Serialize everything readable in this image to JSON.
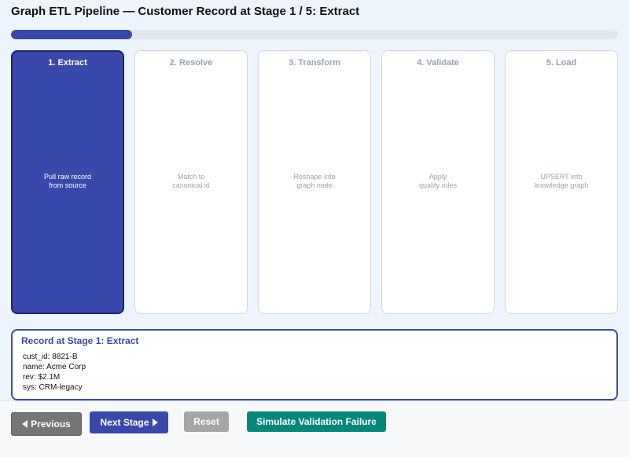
{
  "title": "Graph ETL Pipeline — Customer Record at Stage 1 / 5: Extract",
  "progress": {
    "current_stage": 1,
    "total_stages": 5,
    "fraction": 0.2
  },
  "stages": [
    {
      "label": "1. Extract",
      "desc": [
        "Pull raw record",
        "from source"
      ],
      "active": true
    },
    {
      "label": "2. Resolve",
      "desc": [
        "Match to",
        "canonical id"
      ],
      "active": false
    },
    {
      "label": "3. Transform",
      "desc": [
        "Reshape into",
        "graph node"
      ],
      "active": false
    },
    {
      "label": "4. Validate",
      "desc": [
        "Apply",
        "quality rules"
      ],
      "active": false
    },
    {
      "label": "5. Load",
      "desc": [
        "UPSERT into",
        "knowledge graph"
      ],
      "active": false
    }
  ],
  "record": {
    "title": "Record at Stage 1: Extract",
    "fields": [
      "cust_id: 8821-B",
      "name: Acme Corp",
      "rev: $2.1M",
      "sys: CRM-legacy"
    ]
  },
  "buttons": {
    "previous": "Previous",
    "next": "Next Stage",
    "reset": "Reset",
    "simulate": "Simulate Validation Failure"
  },
  "colors": {
    "accent": "#3949ab",
    "accent_dark": "#1a237e",
    "muted_text": "#9aa3ad",
    "teal": "#00897b",
    "gray_button": "#757575"
  },
  "icons": {
    "previous": "triangle-left-icon",
    "next": "triangle-right-icon"
  }
}
